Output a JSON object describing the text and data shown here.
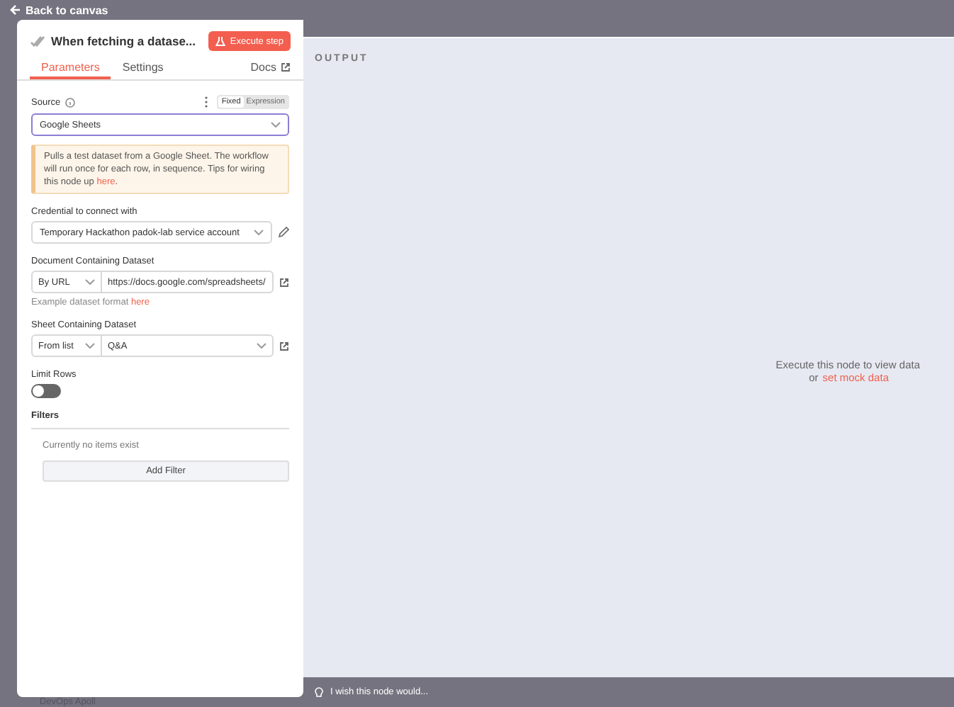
{
  "back_link": "Back to canvas",
  "node": {
    "title": "When fetching a datase...",
    "execute_button": "Execute step"
  },
  "tabs": [
    {
      "label": "Parameters",
      "selected": true
    },
    {
      "label": "Settings",
      "selected": false
    }
  ],
  "docs_link": "Docs",
  "source": {
    "label": "Source",
    "modes": [
      {
        "label": "Fixed",
        "selected": true
      },
      {
        "label": "Expression",
        "selected": false
      }
    ],
    "value": "Google Sheets"
  },
  "notice": {
    "text": "Pulls a test dataset from a Google Sheet. The workflow will run once for each row, in sequence. Tips for wiring this node up ",
    "link": "here",
    "end": "."
  },
  "credential": {
    "label": "Credential to connect with",
    "value": "Temporary Hackathon padok-lab service account"
  },
  "document": {
    "label": "Document Containing Dataset",
    "mode": "By URL",
    "value": "https://docs.google.com/spreadsheets/",
    "hint": "Example dataset format ",
    "hint_link": "here"
  },
  "sheet": {
    "label": "Sheet Containing Dataset",
    "mode": "From list",
    "value": "Q&A"
  },
  "limit_rows": {
    "label": "Limit Rows",
    "on": false
  },
  "filters": {
    "label": "Filters",
    "empty": "Currently no items exist",
    "button": "Add Filter"
  },
  "output": {
    "heading": "OUTPUT",
    "message": "Execute this node to view data",
    "or": "or",
    "link": "set mock data"
  },
  "feedback": "I wish this node would...",
  "canvas_label": "DevOps Apoll"
}
